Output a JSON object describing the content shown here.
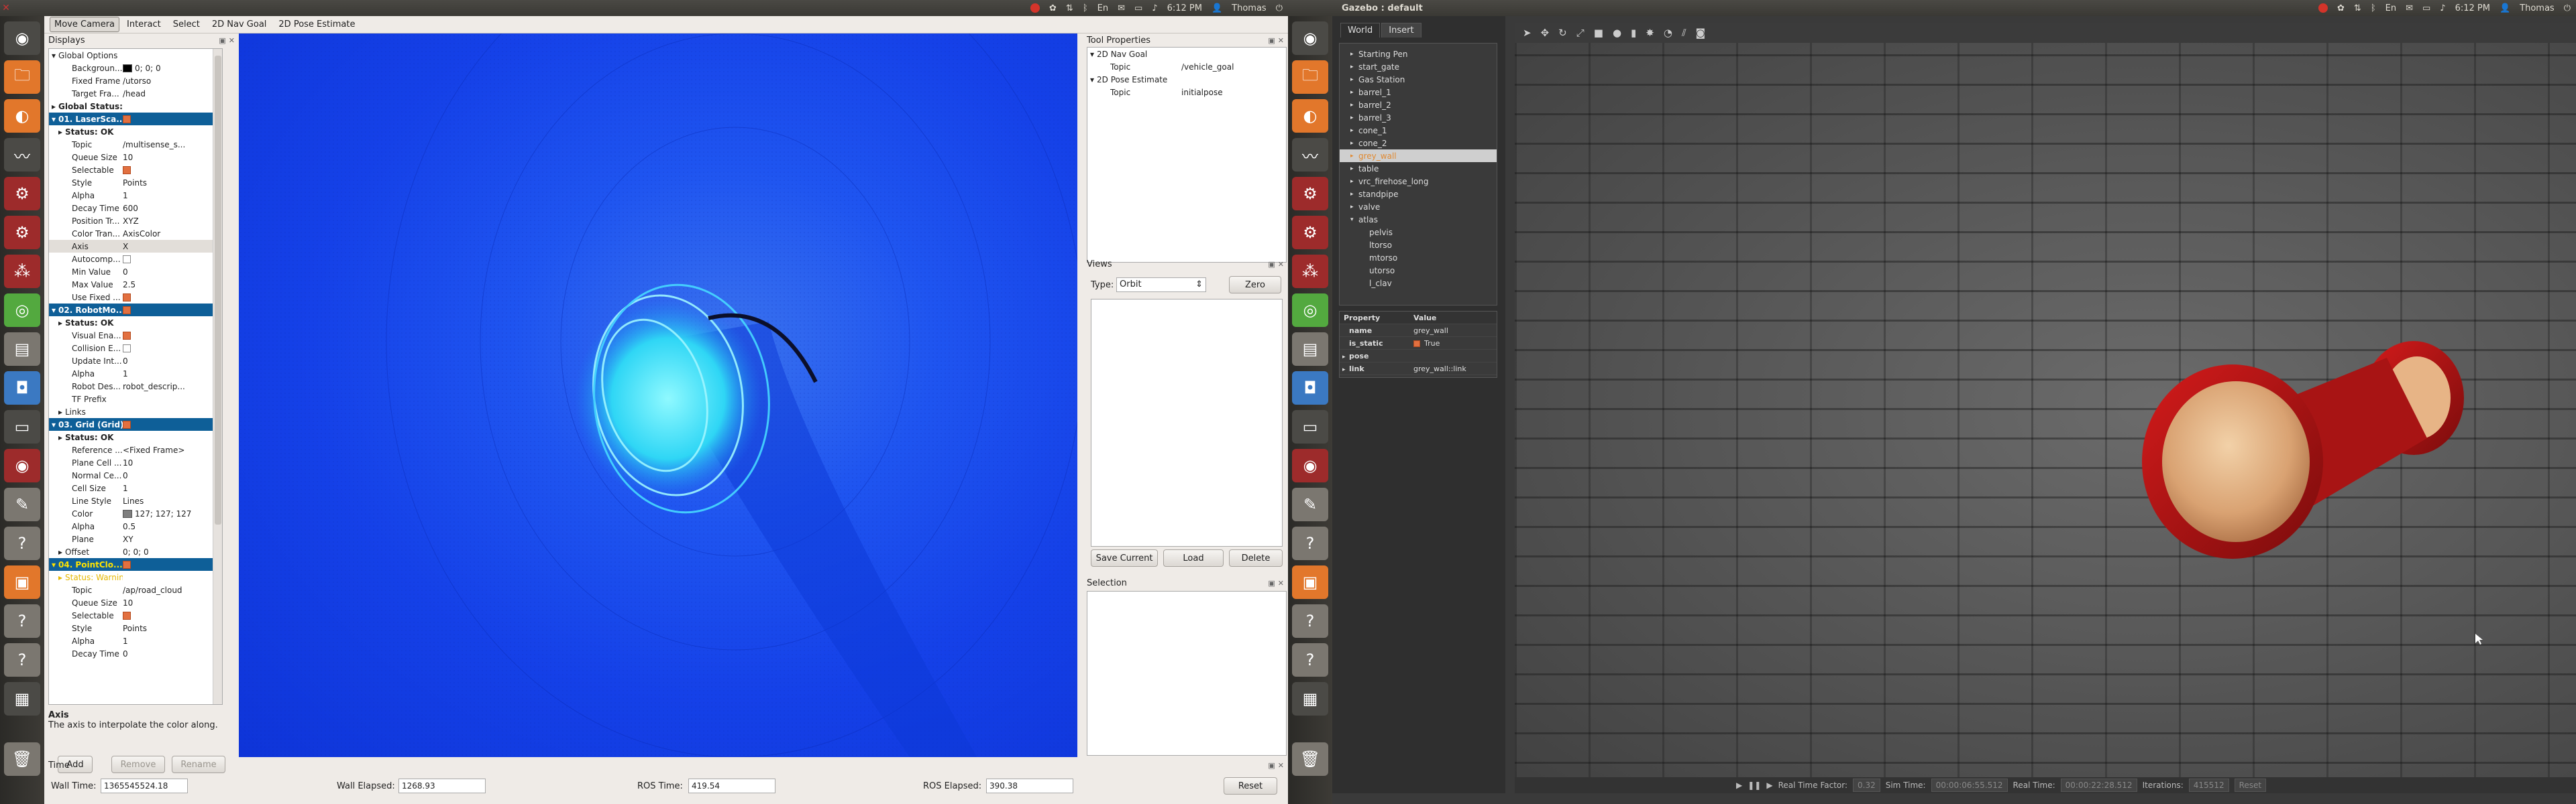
{
  "left_panel": {
    "time": "6:12 PM",
    "user": "Thomas"
  },
  "right_panel": {
    "title": "Gazebo : default",
    "time": "6:12 PM",
    "user": "Thomas"
  },
  "launcher_icons": [
    "ubuntu-home-icon",
    "files-icon",
    "firefox-icon",
    "system-monitor-icon",
    "settings-icon",
    "software-center-icon",
    "bits-icon",
    "network-icon",
    "terminal-icon",
    "app-icon",
    "editor-icon",
    "help-icon",
    "package-icon",
    "help-icon",
    "help-icon",
    "workspace-icon",
    "trash-icon"
  ],
  "rviz": {
    "toolbar": [
      "Move Camera",
      "Interact",
      "Select",
      "2D Nav Goal",
      "2D Pose Estimate"
    ],
    "displays": {
      "title": "Displays",
      "rows": [
        {
          "k": "Global Options",
          "v": "",
          "cls": "",
          "ind": 0,
          "arrow": "▾"
        },
        {
          "k": "Backgroun...",
          "v": "0; 0; 0",
          "cls": "",
          "ind": 2,
          "swatch": "#000000"
        },
        {
          "k": "Fixed Frame",
          "v": "/utorso",
          "cls": "",
          "ind": 2
        },
        {
          "k": "Target Fra...",
          "v": "/head",
          "cls": "",
          "ind": 2
        },
        {
          "k": "Global Status: OK",
          "v": "",
          "cls": "ok",
          "ind": 0,
          "arrow": "▸"
        },
        {
          "k": "01. LaserSca...",
          "v": "",
          "cls": "hl",
          "ind": 0,
          "arrow": "▾",
          "chk": true
        },
        {
          "k": "Status: OK",
          "v": "",
          "cls": "ok",
          "ind": 1,
          "arrow": "▸"
        },
        {
          "k": "Topic",
          "v": "/multisense_s...",
          "cls": "",
          "ind": 2
        },
        {
          "k": "Queue Size",
          "v": "10",
          "cls": "",
          "ind": 2
        },
        {
          "k": "Selectable",
          "v": "",
          "cls": "",
          "ind": 2,
          "chk": true
        },
        {
          "k": "Style",
          "v": "Points",
          "cls": "",
          "ind": 2
        },
        {
          "k": "Alpha",
          "v": "1",
          "cls": "",
          "ind": 2
        },
        {
          "k": "Decay Time",
          "v": "600",
          "cls": "",
          "ind": 2
        },
        {
          "k": "Position Tr...",
          "v": "XYZ",
          "cls": "",
          "ind": 2
        },
        {
          "k": "Color Tran...",
          "v": "AxisColor",
          "cls": "",
          "ind": 2
        },
        {
          "k": "Axis",
          "v": "X",
          "cls": "sel",
          "ind": 2
        },
        {
          "k": "Autocomp...",
          "v": "",
          "cls": "",
          "ind": 2,
          "chk": false
        },
        {
          "k": "Min Value",
          "v": "0",
          "cls": "",
          "ind": 2
        },
        {
          "k": "Max Value",
          "v": "2.5",
          "cls": "",
          "ind": 2
        },
        {
          "k": "Use Fixed ...",
          "v": "",
          "cls": "",
          "ind": 2,
          "chk": true
        },
        {
          "k": "02. RobotMo...",
          "v": "",
          "cls": "hl",
          "ind": 0,
          "arrow": "▾",
          "chk": true
        },
        {
          "k": "Status: OK",
          "v": "",
          "cls": "ok",
          "ind": 1,
          "arrow": "▸"
        },
        {
          "k": "Visual Ena...",
          "v": "",
          "cls": "",
          "ind": 2,
          "chk": true
        },
        {
          "k": "Collision E...",
          "v": "",
          "cls": "",
          "ind": 2,
          "chk": false
        },
        {
          "k": "Update Int...",
          "v": "0",
          "cls": "",
          "ind": 2
        },
        {
          "k": "Alpha",
          "v": "1",
          "cls": "",
          "ind": 2
        },
        {
          "k": "Robot Des...",
          "v": "robot_descrip...",
          "cls": "",
          "ind": 2
        },
        {
          "k": "TF Prefix",
          "v": "",
          "cls": "",
          "ind": 2
        },
        {
          "k": "Links",
          "v": "",
          "cls": "",
          "ind": 1,
          "arrow": "▸"
        },
        {
          "k": "03. Grid (Grid)",
          "v": "",
          "cls": "hl",
          "ind": 0,
          "arrow": "▾",
          "chk": true
        },
        {
          "k": "Status: OK",
          "v": "",
          "cls": "ok",
          "ind": 1,
          "arrow": "▸"
        },
        {
          "k": "Reference ...",
          "v": "<Fixed Frame>",
          "cls": "",
          "ind": 2
        },
        {
          "k": "Plane Cell ...",
          "v": "10",
          "cls": "",
          "ind": 2
        },
        {
          "k": "Normal Ce...",
          "v": "0",
          "cls": "",
          "ind": 2
        },
        {
          "k": "Cell Size",
          "v": "1",
          "cls": "",
          "ind": 2
        },
        {
          "k": "Line Style",
          "v": "Lines",
          "cls": "",
          "ind": 2
        },
        {
          "k": "Color",
          "v": "127; 127; 127",
          "cls": "",
          "ind": 2,
          "swatch": "#7f7f7f"
        },
        {
          "k": "Alpha",
          "v": "0.5",
          "cls": "",
          "ind": 2
        },
        {
          "k": "Plane",
          "v": "XY",
          "cls": "",
          "ind": 2
        },
        {
          "k": "Offset",
          "v": "0; 0; 0",
          "cls": "",
          "ind": 1,
          "arrow": "▸"
        },
        {
          "k": "04. PointClo...",
          "v": "",
          "cls": "hlw",
          "ind": 0,
          "arrow": "▾",
          "chk": true
        },
        {
          "k": "Status: Warning",
          "v": "",
          "cls": "warn",
          "ind": 1,
          "arrow": "▸"
        },
        {
          "k": "Topic",
          "v": "/ap/road_cloud",
          "cls": "",
          "ind": 2
        },
        {
          "k": "Queue Size",
          "v": "10",
          "cls": "",
          "ind": 2
        },
        {
          "k": "Selectable",
          "v": "",
          "cls": "",
          "ind": 2,
          "chk": true
        },
        {
          "k": "Style",
          "v": "Points",
          "cls": "",
          "ind": 2
        },
        {
          "k": "Alpha",
          "v": "1",
          "cls": "",
          "ind": 2
        },
        {
          "k": "Decay Time",
          "v": "0",
          "cls": "",
          "ind": 2
        }
      ],
      "desc_title": "Axis",
      "desc_text": "The axis to interpolate the color along.",
      "add": "Add",
      "remove": "Remove",
      "rename": "Rename"
    },
    "tool_properties": {
      "title": "Tool Properties",
      "rows": [
        {
          "k": "2D Nav Goal",
          "v": "",
          "ind": 0,
          "arrow": "▾"
        },
        {
          "k": "Topic",
          "v": "/vehicle_goal",
          "ind": 2
        },
        {
          "k": "2D Pose Estimate",
          "v": "",
          "ind": 0,
          "arrow": "▾"
        },
        {
          "k": "Topic",
          "v": "initialpose",
          "ind": 2
        }
      ]
    },
    "views": {
      "title": "Views",
      "type_label": "Type:",
      "type_value": "Orbit",
      "zero": "Zero",
      "save": "Save Current",
      "load": "Load",
      "delete": "Delete"
    },
    "selection": {
      "title": "Selection"
    },
    "time": {
      "title": "Time",
      "wall_time_label": "Wall Time:",
      "wall_time": "1365545524.18",
      "wall_elapsed_label": "Wall Elapsed:",
      "wall_elapsed": "1268.93",
      "ros_time_label": "ROS Time:",
      "ros_time": "419.54",
      "ros_elapsed_label": "ROS Elapsed:",
      "ros_elapsed": "390.38",
      "reset": "Reset"
    }
  },
  "gazebo": {
    "tabs": [
      "World",
      "Insert"
    ],
    "tree": [
      {
        "t": "Starting Pen",
        "ind": 1
      },
      {
        "t": "start_gate",
        "ind": 1
      },
      {
        "t": "Gas Station",
        "ind": 1
      },
      {
        "t": "barrel_1",
        "ind": 1
      },
      {
        "t": "barrel_2",
        "ind": 1
      },
      {
        "t": "barrel_3",
        "ind": 1
      },
      {
        "t": "cone_1",
        "ind": 1
      },
      {
        "t": "cone_2",
        "ind": 1
      },
      {
        "t": "grey_wall",
        "ind": 1,
        "selected": true
      },
      {
        "t": "table",
        "ind": 1
      },
      {
        "t": "vrc_firehose_long",
        "ind": 1
      },
      {
        "t": "standpipe",
        "ind": 1
      },
      {
        "t": "valve",
        "ind": 1
      },
      {
        "t": "atlas",
        "ind": 1,
        "arrow": "▾"
      },
      {
        "t": "pelvis",
        "ind": 2
      },
      {
        "t": "ltorso",
        "ind": 2
      },
      {
        "t": "mtorso",
        "ind": 2
      },
      {
        "t": "utorso",
        "ind": 2
      },
      {
        "t": "l_clav",
        "ind": 2
      }
    ],
    "prop_header": {
      "k": "Property",
      "v": "Value"
    },
    "props": [
      {
        "k": "name",
        "v": "grey_wall"
      },
      {
        "k": "is_static",
        "v": "True",
        "chk": true
      },
      {
        "k": "pose",
        "v": "",
        "arrow": "▸"
      },
      {
        "k": "link",
        "v": "grey_wall::link",
        "arrow": "▸"
      }
    ],
    "status": {
      "rtf_label": "Real Time Factor:",
      "rtf": "0.32",
      "sim_label": "Sim Time:",
      "sim": "00:00:06:55.512",
      "real_label": "Real Time:",
      "real": "00:00:22:28.512",
      "iter_label": "Iterations:",
      "iter": "415512",
      "reset": "Reset"
    }
  }
}
